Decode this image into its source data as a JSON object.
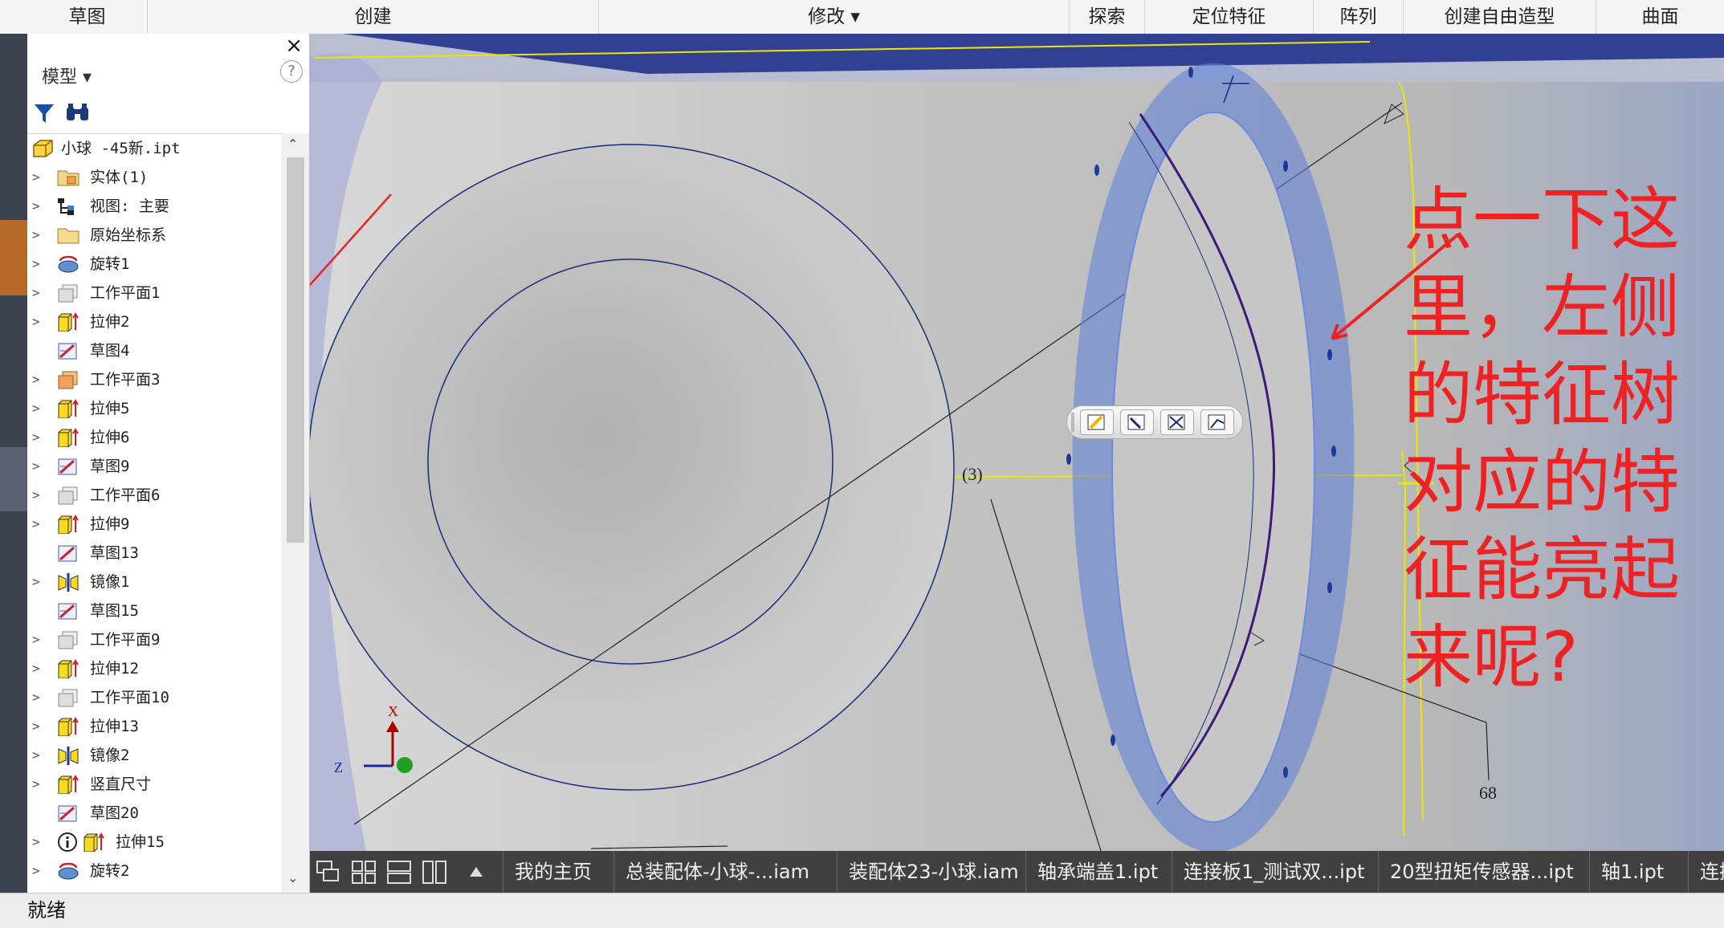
{
  "ribbon": {
    "tabs": [
      "草图",
      "创建",
      "修改 ▾",
      "探索",
      "定位特征",
      "阵列",
      "创建自由造型",
      "曲面"
    ]
  },
  "panel": {
    "close_glyph": "×",
    "title": "模型 ▾",
    "help_glyph": "?",
    "tree_items": [
      {
        "label": "小球 -45新.ipt",
        "icon": "part-icon"
      },
      {
        "label": "实体(1)",
        "icon": "solid-bodies-folder-icon"
      },
      {
        "label": "视图: 主要",
        "icon": "view-rep-icon"
      },
      {
        "label": "原始坐标系",
        "icon": "origin-folder-icon"
      },
      {
        "label": "旋转1",
        "icon": "revolve-icon"
      },
      {
        "label": "工作平面1",
        "icon": "work-plane-icon"
      },
      {
        "label": "拉伸2",
        "icon": "extrude-icon"
      },
      {
        "label": "草图4",
        "icon": "sketch-icon"
      },
      {
        "label": "工作平面3",
        "icon": "work-plane-orange-icon"
      },
      {
        "label": "拉伸5",
        "icon": "extrude-icon"
      },
      {
        "label": "拉伸6",
        "icon": "extrude-icon"
      },
      {
        "label": "草图9",
        "icon": "sketch-icon"
      },
      {
        "label": "工作平面6",
        "icon": "work-plane-icon"
      },
      {
        "label": "拉伸9",
        "icon": "extrude-icon"
      },
      {
        "label": "草图13",
        "icon": "sketch-icon"
      },
      {
        "label": "镜像1",
        "icon": "mirror-icon"
      },
      {
        "label": "草图15",
        "icon": "sketch-icon"
      },
      {
        "label": "工作平面9",
        "icon": "work-plane-icon"
      },
      {
        "label": "拉伸12",
        "icon": "extrude-icon"
      },
      {
        "label": "工作平面10",
        "icon": "work-plane-icon"
      },
      {
        "label": "拉伸13",
        "icon": "extrude-icon"
      },
      {
        "label": "镜像2",
        "icon": "mirror-icon"
      },
      {
        "label": "竖直尺寸",
        "icon": "extrude-icon"
      },
      {
        "label": "草图20",
        "icon": "sketch-icon"
      },
      {
        "label": "拉伸15",
        "icon": "extrude-icon"
      },
      {
        "label": "旋转2",
        "icon": "revolve-icon"
      }
    ]
  },
  "viewport": {
    "dimension_label_3": "(3)",
    "dimension_label_68": "68",
    "axis_x": "X",
    "axis_z": "Z"
  },
  "annotation": {
    "lines": [
      "点一下这",
      "里，左侧",
      "的特征树",
      "对应的特",
      "征能亮起",
      "来呢?"
    ],
    "color": "#ee2222"
  },
  "document_tabs": [
    "我的主页",
    "总装配体-小球-...iam",
    "装配体23-小球.iam",
    "轴承端盖1.ipt",
    "连接板1_测试双...ipt",
    "20型扭矩传感器...ipt",
    "轴1.ipt",
    "连接"
  ],
  "status_text": "就绪",
  "colors": {
    "accent_orange": "#f0a020",
    "sketch_blue": "#1a2a7a",
    "highlight_blue": "#5b7fd8",
    "annotation_red": "#ee2222"
  }
}
